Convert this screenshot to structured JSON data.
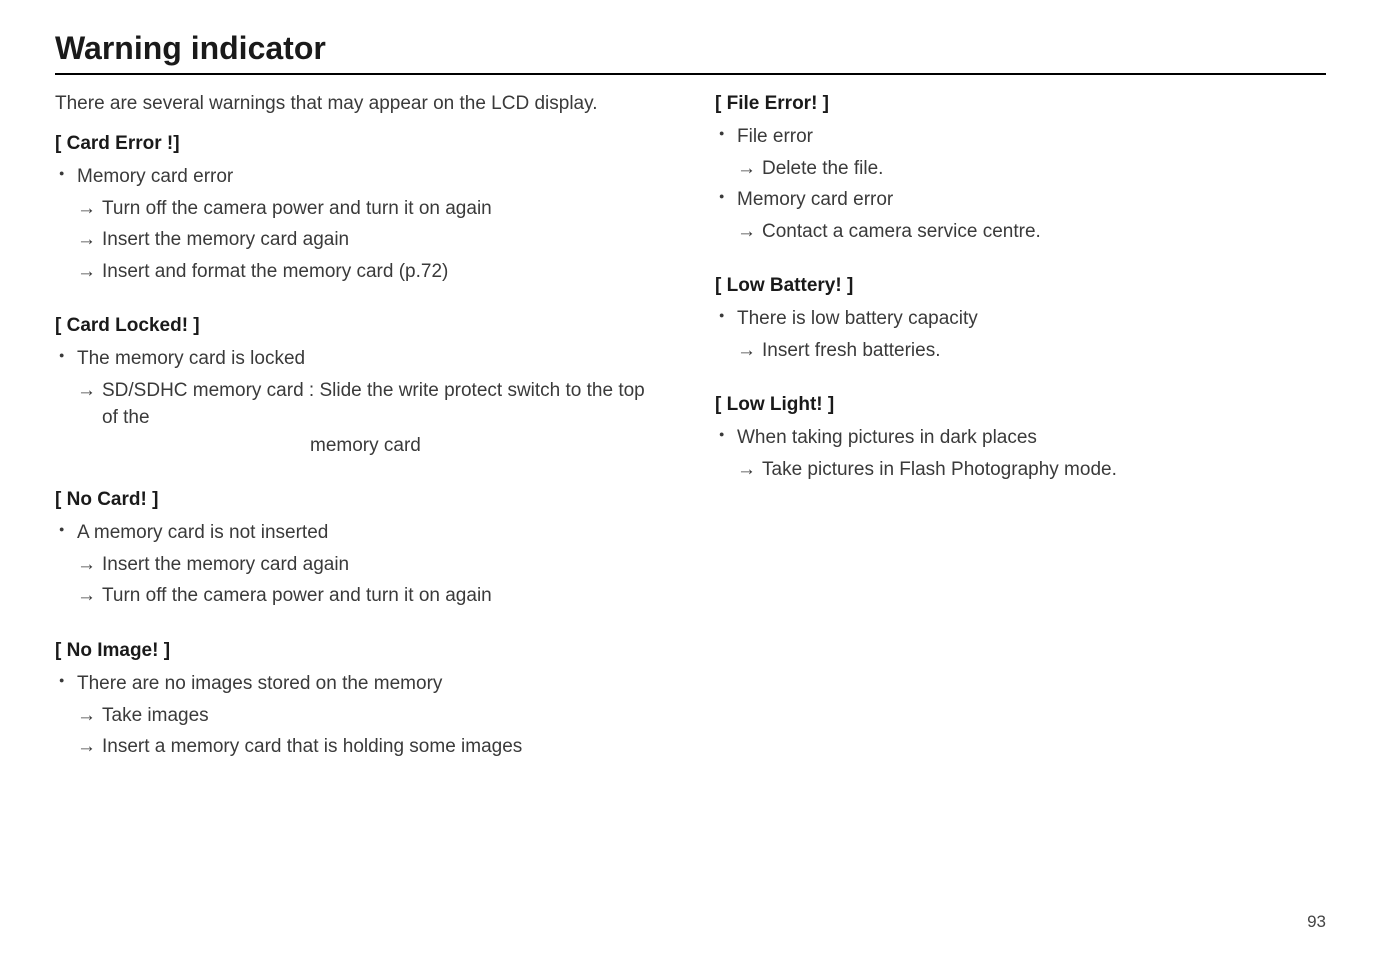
{
  "title": "Warning indicator",
  "intro": "There are several warnings that may appear on the LCD display.",
  "left": {
    "s1": {
      "head": "[ Card Error !]",
      "b1": "Memory card error",
      "a1": "Turn off the camera power and turn it on again",
      "a2": "Insert the memory card again",
      "a3": "Insert and format the memory card (p.72)"
    },
    "s2": {
      "head": "[ Card Locked! ]",
      "b1": "The memory card is locked",
      "a1_pre": "SD/SDHC memory card : Slide the write protect switch to the top of the",
      "a1_hang": "memory card"
    },
    "s3": {
      "head": "[ No Card! ]",
      "b1": "A memory card is not inserted",
      "a1": "Insert the memory card again",
      "a2": "Turn off the camera power and turn it on again"
    },
    "s4": {
      "head": "[ No Image! ]",
      "b1": "There are no images stored on the memory",
      "a1": "Take images",
      "a2": "Insert a memory card that is holding some images"
    }
  },
  "right": {
    "s1": {
      "head": "[ File Error! ]",
      "b1": "File error",
      "a1": "Delete the file.",
      "b2": "Memory card error",
      "a2": "Contact a camera service centre."
    },
    "s2": {
      "head": "[ Low Battery! ]",
      "b1": "There is low battery capacity",
      "a1": "Insert fresh batteries."
    },
    "s3": {
      "head": "[ Low Light! ]",
      "b1": "When taking pictures in dark places",
      "a1": "Take pictures in Flash Photography mode."
    }
  },
  "arrow": "→",
  "pagenum": "93"
}
